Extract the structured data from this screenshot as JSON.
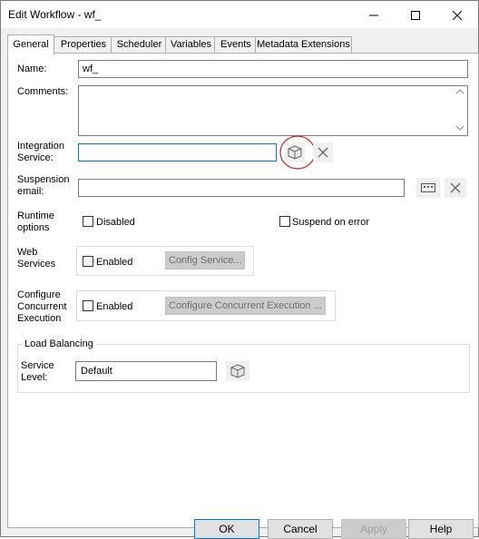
{
  "window": {
    "title": "Edit Workflow - wf_"
  },
  "tabs": [
    {
      "label": "General"
    },
    {
      "label": "Properties"
    },
    {
      "label": "Scheduler"
    },
    {
      "label": "Variables"
    },
    {
      "label": "Events"
    },
    {
      "label": "Metadata Extensions"
    }
  ],
  "form": {
    "name_label": "Name:",
    "name_value": "wf_",
    "comments_label": "Comments:",
    "comments_value": "",
    "integration_label_1": "Integration",
    "integration_label_2": "Service:",
    "integration_value": "",
    "suspension_label_1": "Suspension",
    "suspension_label_2": "email:",
    "suspension_value": "",
    "runtime_label_1": "Runtime",
    "runtime_label_2": "options",
    "disabled_label": "Disabled",
    "suspend_label": "Suspend on error",
    "web_label_1": "Web",
    "web_label_2": "Services",
    "web_enabled_label": "Enabled",
    "config_service_label": "Config Service...",
    "concurrent_label_1": "Configure",
    "concurrent_label_2": "Concurrent",
    "concurrent_label_3": "Execution",
    "concurrent_enabled_label": "Enabled",
    "configure_concurrent_label": "Configure Concurrent Execution ..."
  },
  "load_balancing": {
    "legend": "Load Balancing",
    "service_level_label_1": "Service",
    "service_level_label_2": "Level:",
    "service_level_value": "Default"
  },
  "buttons": {
    "ok": "OK",
    "cancel": "Cancel",
    "apply": "Apply",
    "help": "Help"
  },
  "colors": {
    "focus_border": "#0078d7",
    "highlight_circle": "#cc2222"
  }
}
